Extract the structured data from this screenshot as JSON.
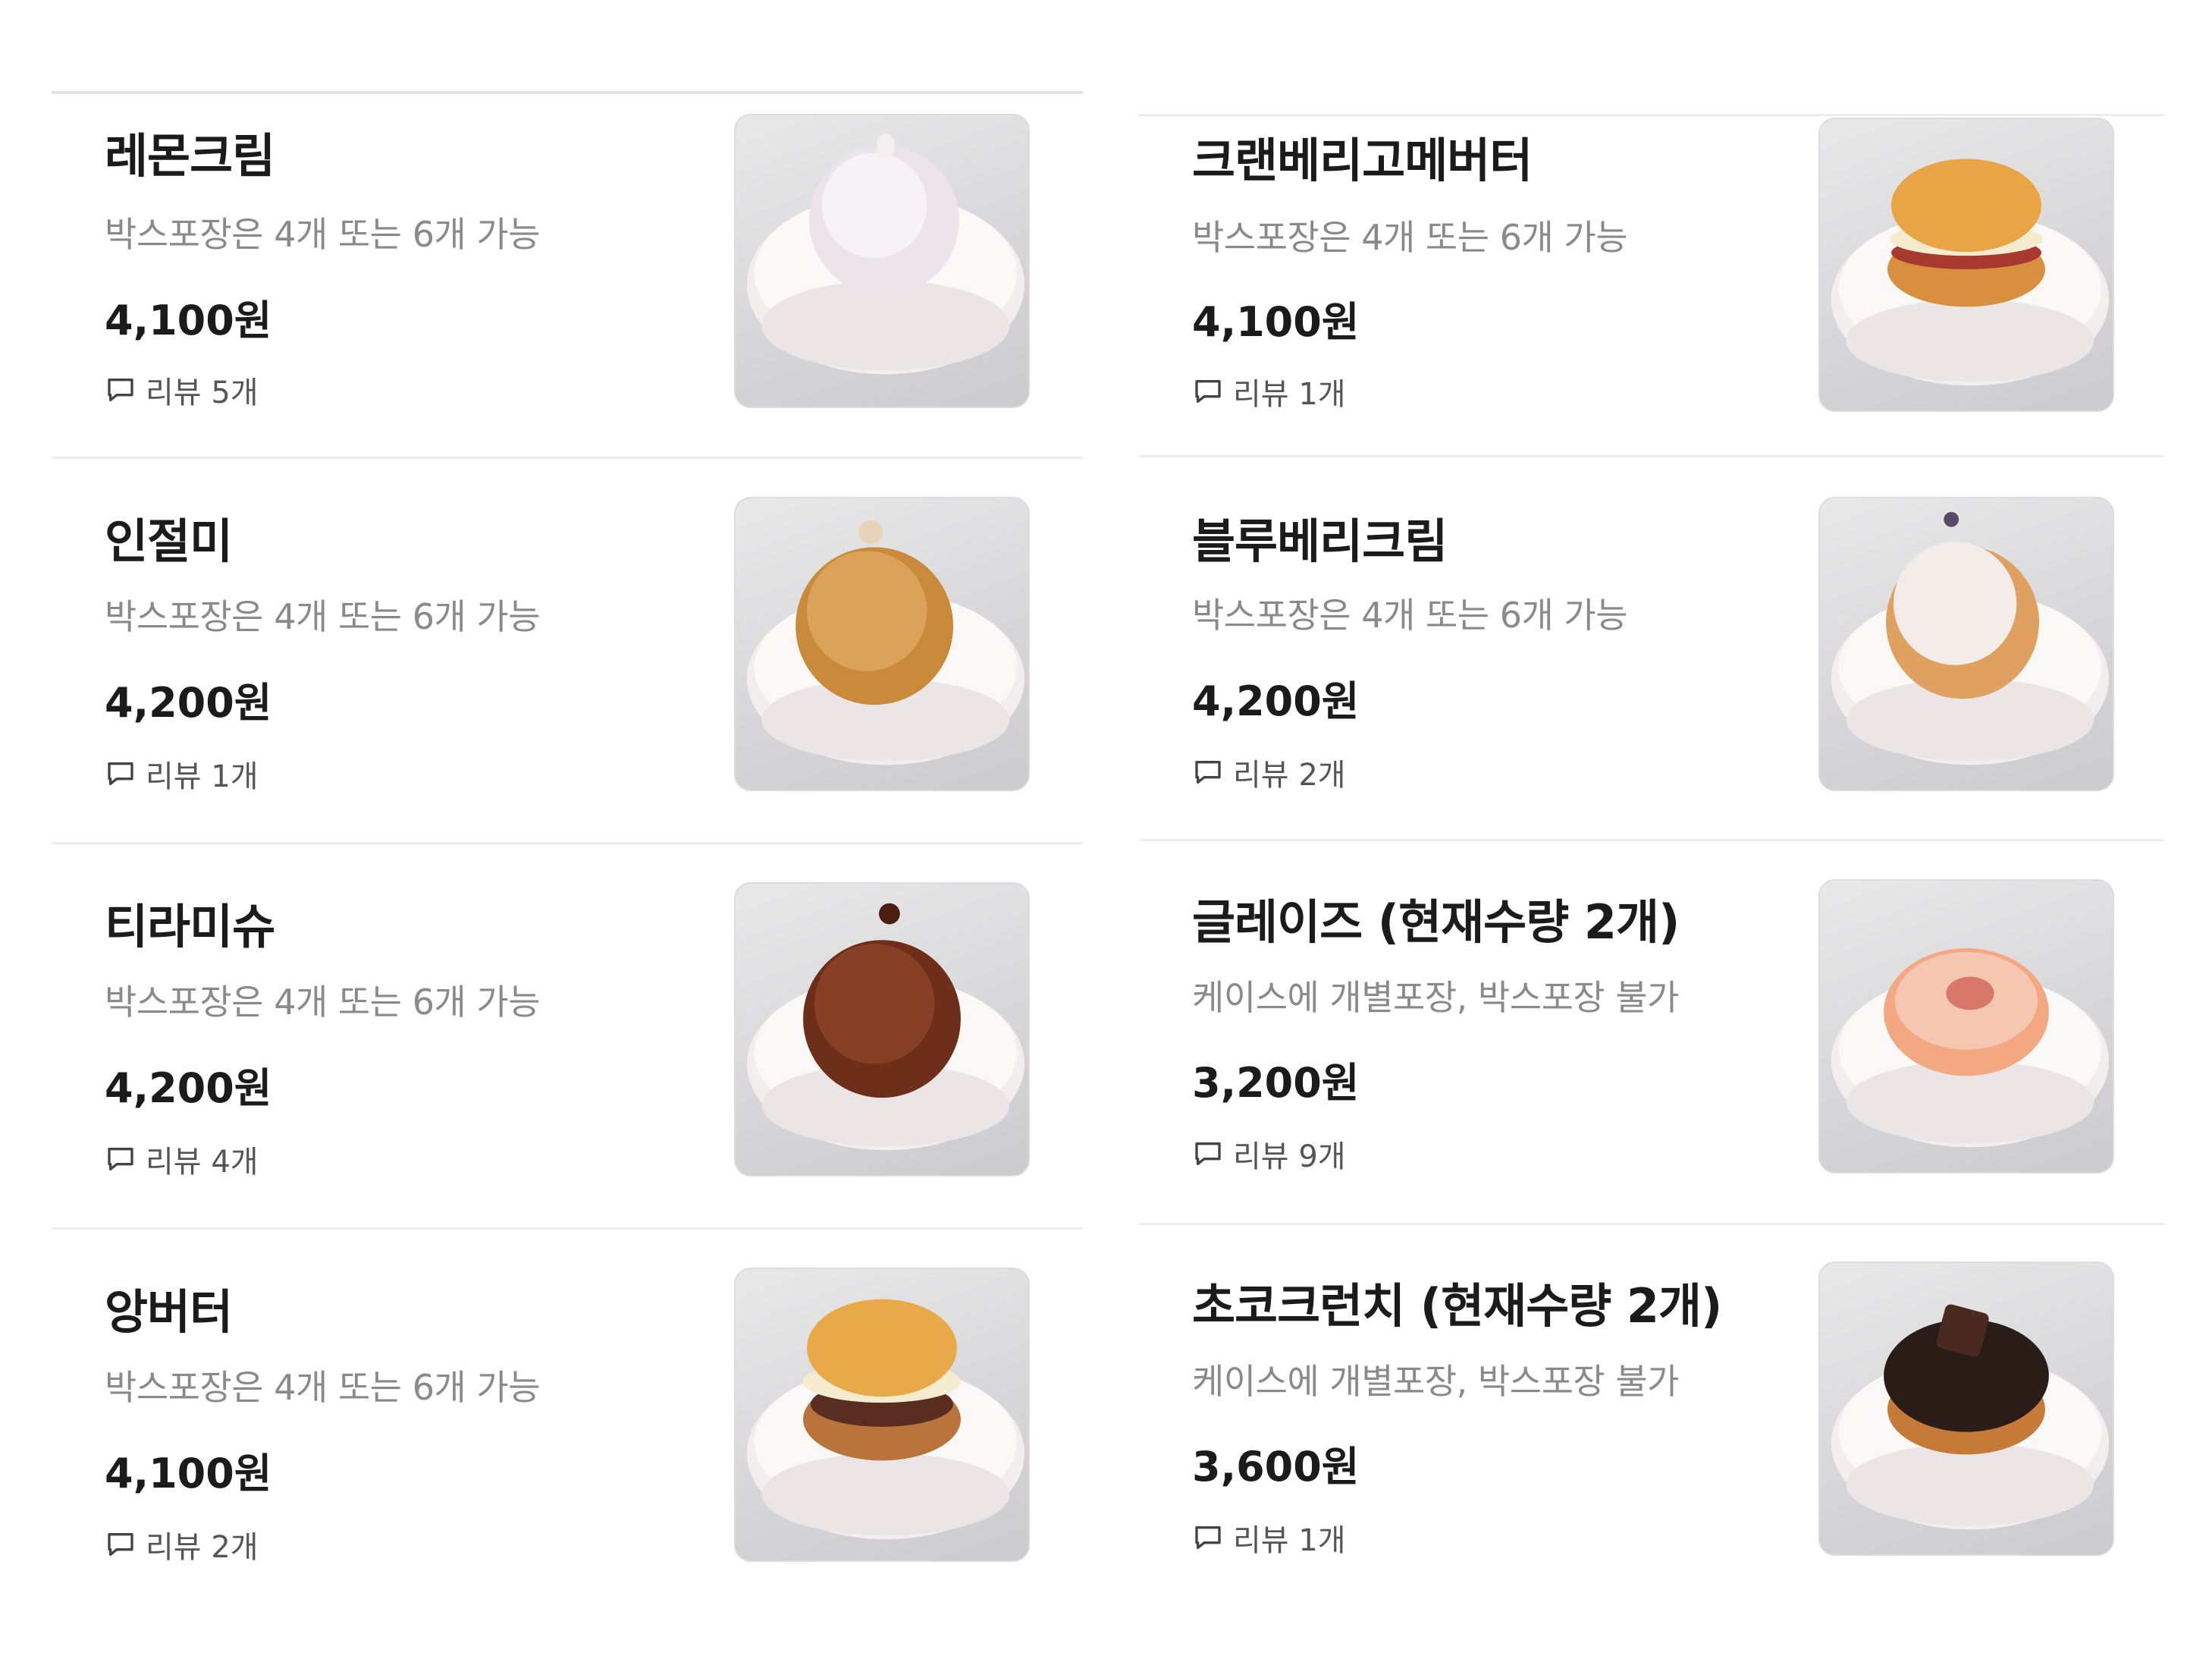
{
  "items_left": [
    {
      "name": "레몬크림",
      "description": "박스포장은 4개 또는 6개 가능",
      "price": "4,100원",
      "review_label": "리뷰 5개",
      "photo_icon": "lemon-cream-donut-photo"
    },
    {
      "name": "인절미",
      "description": "박스포장은 4개 또는 6개 가능",
      "price": "4,200원",
      "review_label": "리뷰 1개",
      "photo_icon": "injeolmi-donut-photo"
    },
    {
      "name": "티라미슈",
      "description": "박스포장은 4개 또는 6개 가능",
      "price": "4,200원",
      "review_label": "리뷰 4개",
      "photo_icon": "tiramisu-donut-photo"
    },
    {
      "name": "앙버터",
      "description": "박스포장은 4개 또는 6개 가능",
      "price": "4,100원",
      "review_label": "리뷰 2개",
      "photo_icon": "red-bean-butter-donut-photo"
    }
  ],
  "items_right": [
    {
      "name": "크랜베리고메버터",
      "description": "박스포장은 4개 또는 6개 가능",
      "price": "4,100원",
      "review_label": "리뷰 1개",
      "photo_icon": "cranberry-butter-donut-photo"
    },
    {
      "name": "블루베리크림",
      "description": "박스포장은 4개 또는 6개 가능",
      "price": "4,200원",
      "review_label": "리뷰 2개",
      "photo_icon": "blueberry-cream-donut-photo"
    },
    {
      "name": "글레이즈 (현재수량 2개)",
      "description": "케이스에 개별포장, 박스포장 불가",
      "price": "3,200원",
      "review_label": "리뷰 9개",
      "photo_icon": "glazed-donut-photo"
    },
    {
      "name": "초코크런치 (현재수량 2개)",
      "description": "케이스에 개별포장, 박스포장 불가",
      "price": "3,600원",
      "review_label": "리뷰 1개",
      "photo_icon": "choco-crunch-donut-photo"
    }
  ],
  "colors": {
    "title": "#1b1b1b",
    "description": "#8a8a8a",
    "review": "#555555",
    "divider": "#ededed"
  }
}
